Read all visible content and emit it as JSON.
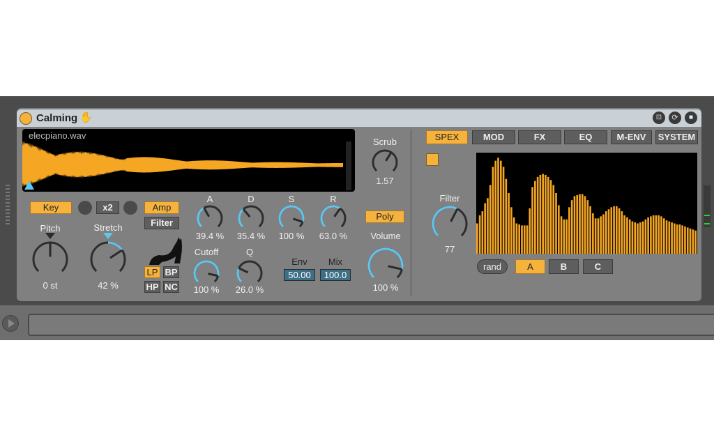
{
  "device": {
    "title": "Calming",
    "accent": "#f5b33e",
    "knob_blue": "#5ec6ef"
  },
  "sample": {
    "filename": "elecpiano.wav"
  },
  "buttons": {
    "key": "Key",
    "x2": "x2",
    "amp": "Amp",
    "filter": "Filter",
    "lp": "LP",
    "bp": "BP",
    "hp": "HP",
    "nc": "NC",
    "poly": "Poly",
    "rand": "rand"
  },
  "knobs": {
    "scrub": {
      "label": "Scrub",
      "display": "1.57",
      "value": 0.62,
      "blue": false
    },
    "pitch": {
      "label": "Pitch",
      "display": "0 st",
      "value": 0.5,
      "blue": false
    },
    "stretch": {
      "label": "Stretch",
      "display": "42 %",
      "value": 0.71,
      "blue": true,
      "bipolar": true
    },
    "a": {
      "label": "A",
      "display": "39.4 %",
      "value": 0.39,
      "blue": true
    },
    "d": {
      "label": "D",
      "display": "35.4 %",
      "value": 0.35,
      "blue": true
    },
    "s": {
      "label": "S",
      "display": "100 %",
      "value": 0.9,
      "blue": true
    },
    "r": {
      "label": "R",
      "display": "63.0 %",
      "value": 0.63,
      "blue": true
    },
    "cutoff": {
      "label": "Cutoff",
      "display": "100 %",
      "value": 0.88,
      "blue": true
    },
    "q": {
      "label": "Q",
      "display": "26.0 %",
      "value": 0.26,
      "blue": true
    },
    "volume": {
      "label": "Volume",
      "display": "100 %",
      "value": 0.88,
      "blue": true
    },
    "filter": {
      "label": "Filter",
      "display": "77",
      "value": 0.6,
      "blue": true
    }
  },
  "env": {
    "label": "Env",
    "value": "50.00"
  },
  "mix": {
    "label": "Mix",
    "value": "100.0"
  },
  "tabs": [
    {
      "label": "SPEX",
      "active": true
    },
    {
      "label": "MOD"
    },
    {
      "label": "FX"
    },
    {
      "label": "EQ"
    },
    {
      "label": "M-ENV"
    },
    {
      "label": "SYSTEM"
    }
  ],
  "presets": [
    {
      "label": "A",
      "active": true
    },
    {
      "label": "B"
    },
    {
      "label": "C"
    }
  ],
  "spectrum_levels": [
    0.3,
    0.38,
    0.42,
    0.5,
    0.55,
    0.68,
    0.86,
    0.92,
    0.95,
    0.92,
    0.86,
    0.74,
    0.6,
    0.46,
    0.36,
    0.3,
    0.29,
    0.28,
    0.28,
    0.28,
    0.45,
    0.66,
    0.72,
    0.76,
    0.78,
    0.79,
    0.78,
    0.76,
    0.73,
    0.68,
    0.6,
    0.48,
    0.37,
    0.34,
    0.34,
    0.46,
    0.53,
    0.57,
    0.58,
    0.59,
    0.59,
    0.57,
    0.53,
    0.47,
    0.4,
    0.35,
    0.35,
    0.37,
    0.39,
    0.42,
    0.44,
    0.46,
    0.47,
    0.47,
    0.45,
    0.42,
    0.38,
    0.36,
    0.34,
    0.32,
    0.31,
    0.3,
    0.31,
    0.32,
    0.34,
    0.36,
    0.37,
    0.38,
    0.38,
    0.38,
    0.37,
    0.35,
    0.33,
    0.32,
    0.31,
    0.3,
    0.29,
    0.29,
    0.28,
    0.27,
    0.26,
    0.25,
    0.24,
    0.23
  ]
}
